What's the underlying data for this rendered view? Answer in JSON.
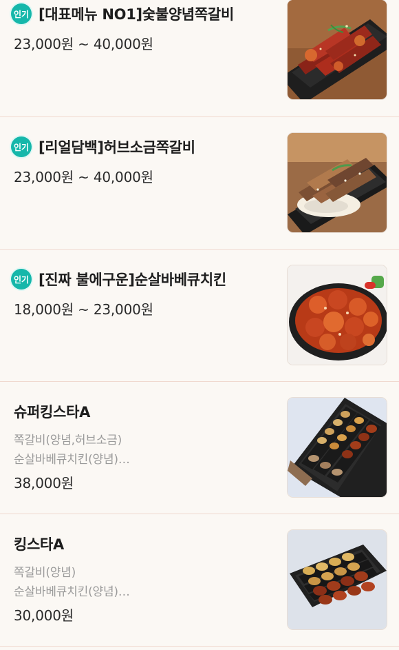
{
  "menu": {
    "items": [
      {
        "badge": "인기",
        "name": "[대표메뉴 NO1]숯불양념쪽갈비",
        "price": "23,000원 ~ 40,000원",
        "image_icon": "bbq-rib-photo"
      },
      {
        "badge": "인기",
        "name": "[리얼담백]허브소금쪽갈비",
        "price": "23,000원 ~ 40,000원",
        "image_icon": "herb-rib-photo"
      },
      {
        "badge": "인기",
        "name": "[진짜 불에구운]순살바베큐치킨",
        "price": "18,000원 ~ 23,000원",
        "image_icon": "bbq-chicken-photo"
      },
      {
        "name": "슈퍼킹스타A",
        "description_line1": "쪽갈비(양념,허브소금)",
        "description_line2": "순살바베큐치킨(양념)…",
        "price": "38,000원",
        "image_icon": "super-set-box-photo"
      },
      {
        "name": "킹스타A",
        "description_line1": "쪽갈비(양념)",
        "description_line2": "순살바베큐치킨(양념)…",
        "price": "30,000원",
        "image_icon": "set-box-photo"
      }
    ]
  },
  "colors": {
    "background": "#fbf8f4",
    "badge": "#16b7aa",
    "divider": "#f0d9cf",
    "title": "#1d1d1d",
    "description": "#9a9a9a"
  }
}
